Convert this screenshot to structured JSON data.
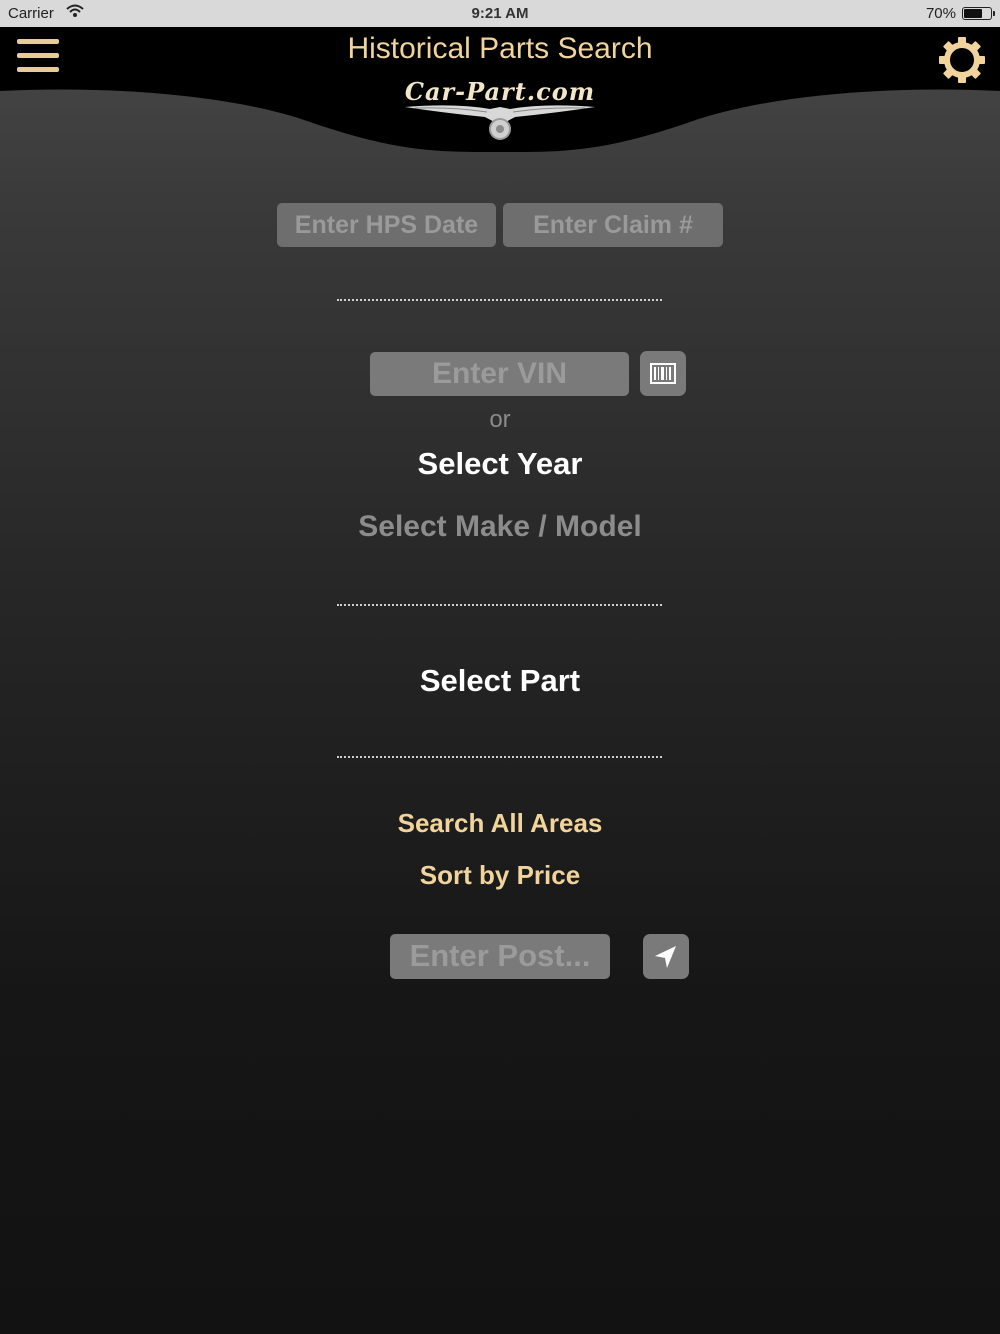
{
  "status_bar": {
    "carrier": "Carrier",
    "time": "9:21 AM",
    "battery": "70%",
    "battery_level": 0.7
  },
  "header": {
    "title": "Historical Parts Search",
    "logo_text": "Car-Part.com",
    "menu_icon": "hamburger-menu-icon",
    "settings_icon": "gear-icon"
  },
  "colors": {
    "accent_gold": "#f0d49c",
    "header_black": "#000000",
    "field_gray": "#777777"
  },
  "form": {
    "hps_date_placeholder": "Enter HPS Date",
    "claim_placeholder": "Enter Claim #",
    "vin_placeholder": "Enter VIN",
    "barcode_icon": "barcode-icon",
    "or_text": "or",
    "select_year": "Select Year",
    "select_make_model": "Select Make / Model",
    "select_part": "Select Part",
    "search_areas": "Search All Areas",
    "sort_by": "Sort by Price",
    "postal_placeholder": "Enter Post...",
    "location_icon": "location-arrow-icon"
  }
}
